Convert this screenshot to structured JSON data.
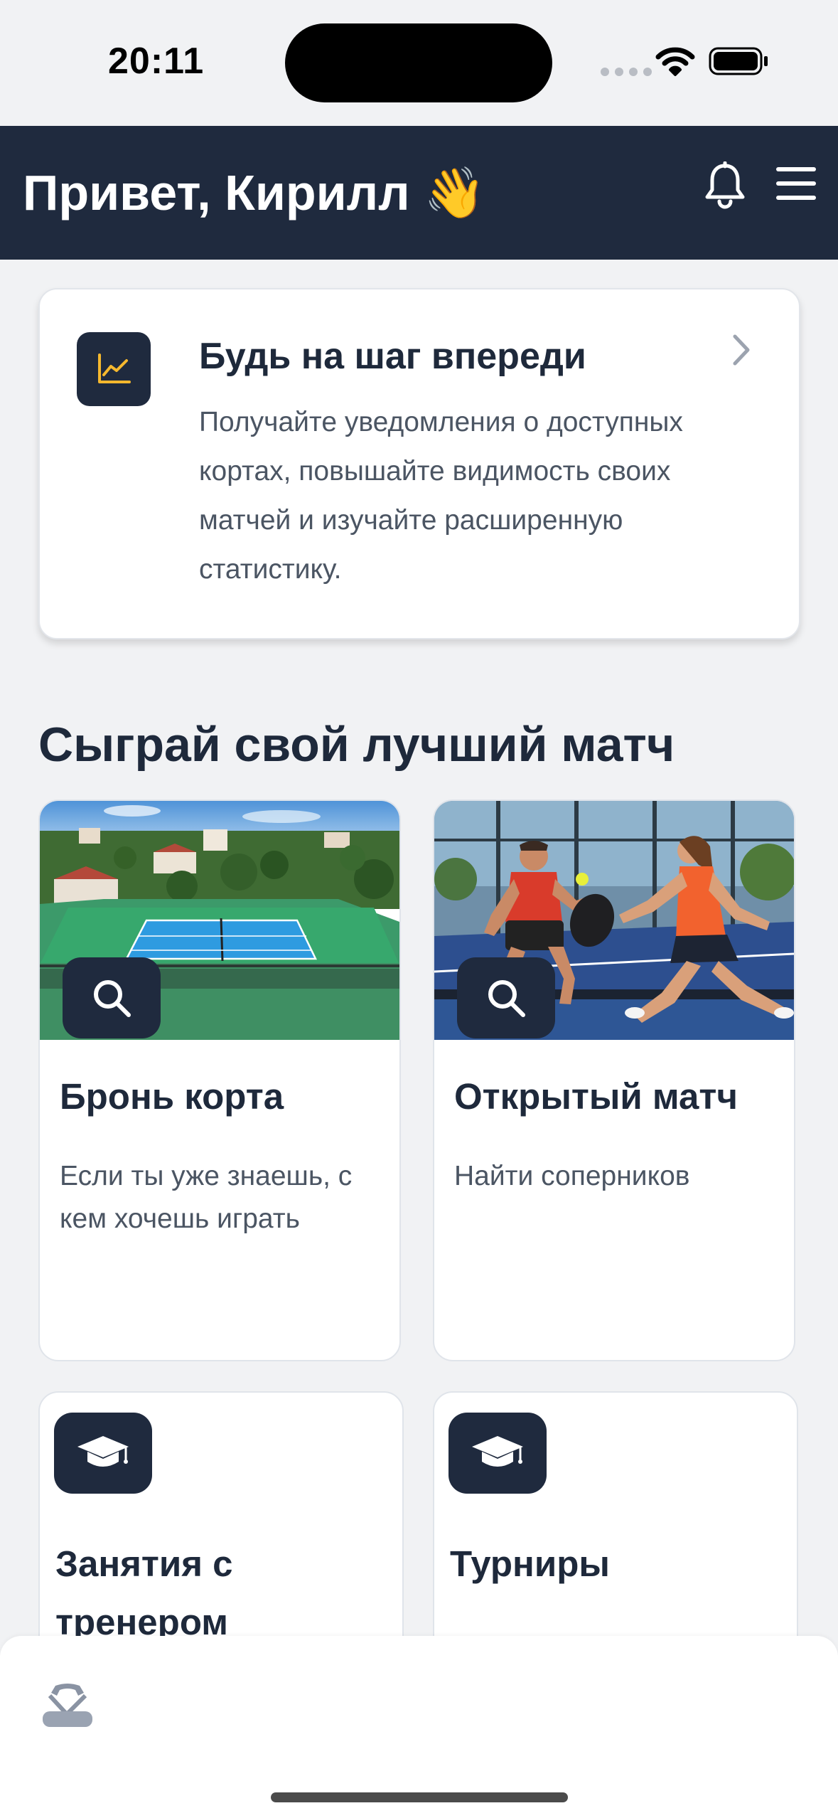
{
  "status_bar": {
    "time": "20:11"
  },
  "header": {
    "greeting": "Привет, Кирилл 👋"
  },
  "promo": {
    "title": "Будь на шаг впереди",
    "text": "Получайте уведомления о доступных кортах, повышайте видимость своих матчей и изучайте расширенную статистику."
  },
  "section": {
    "title": "Сыграй свой лучший матч"
  },
  "features": [
    {
      "title": "Бронь корта",
      "description": "Если ты уже знаешь, с кем хочешь играть"
    },
    {
      "title": "Открытый матч",
      "description": "Найти соперников"
    }
  ],
  "options": [
    {
      "title": "Занятия с тренером"
    },
    {
      "title": "Турниры"
    }
  ],
  "colors": {
    "navy": "#1f2a3e",
    "accent_yellow": "#f5b82e",
    "background": "#f1f2f4"
  },
  "icons": [
    "wifi-icon",
    "battery-icon",
    "bell-icon",
    "menu-icon",
    "chart-line-icon",
    "chevron-right-icon",
    "search-icon",
    "graduation-cap-icon",
    "padel-icon"
  ]
}
